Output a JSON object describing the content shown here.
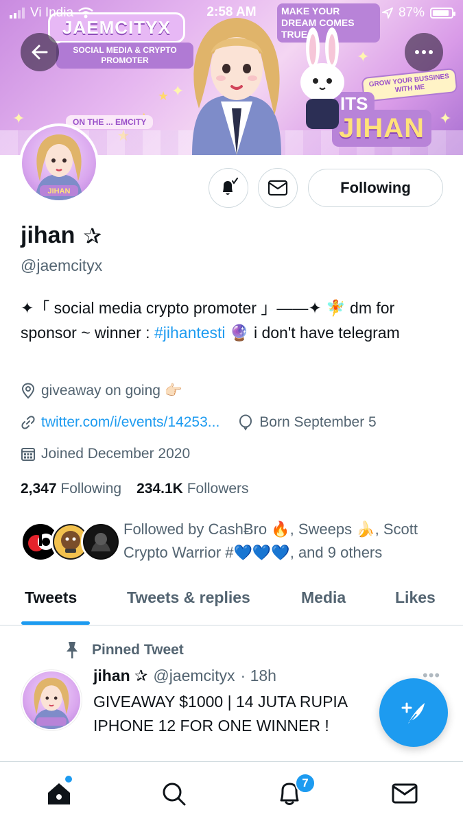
{
  "status_bar": {
    "carrier": "Vi India",
    "time": "2:58 AM",
    "battery": "87%"
  },
  "banner": {
    "logo": "JAEMCITYX",
    "subtitle": "SOCIAL MEDIA & CRYPTO PROMOTER",
    "dream_text": "MAKE YOUR DREAM COMES TRUE",
    "grow_text": "GROW YOUR BUSSINES WITH ME",
    "its_text": "ITS",
    "name_text": "JIHAN",
    "left_deco": "ON THE ... EMCITY",
    "avatar_label": "JIHAN"
  },
  "profile": {
    "display_name": "jihan",
    "name_symbol": "✰",
    "handle": "@jaemcityx",
    "bio_part1": "✦「 social media crypto promoter 」——✦ 🧚 dm for sponsor ~ winner : ",
    "bio_hashtag": "#jihantesti",
    "bio_part2": " 🔮 i don't have telegram",
    "location": "giveaway on going 👉🏻",
    "website": "twitter.com/i/events/14253...",
    "birthday": "Born September 5",
    "joined": "Joined December 2020",
    "following_count": "2,347",
    "following_label": "Following",
    "followers_count": "234.1K",
    "followers_label": "Followers",
    "followed_by": "Followed by CashɃro 🔥, Sweeps 🍌, Scott Crypto Warrior #💙💙💙, and 9 others"
  },
  "actions": {
    "follow_label": "Following"
  },
  "tabs": [
    {
      "label": "Tweets"
    },
    {
      "label": "Tweets & replies"
    },
    {
      "label": "Media"
    },
    {
      "label": "Likes"
    }
  ],
  "tweet": {
    "pinned_label": "Pinned Tweet",
    "name": "jihan ✰",
    "handle": "@jaemcityx",
    "time": "· 18h",
    "text": "GIVEAWAY $1000 | 14 JUTA RUPIA\nIPHONE 12 FOR ONE WINNER !",
    "more": "•••"
  },
  "bottom_nav": {
    "notifications_badge": "7"
  },
  "colors": {
    "accent": "#1d9bf0",
    "text_primary": "#0f1419",
    "text_secondary": "#536471",
    "border": "#cfd9de"
  }
}
